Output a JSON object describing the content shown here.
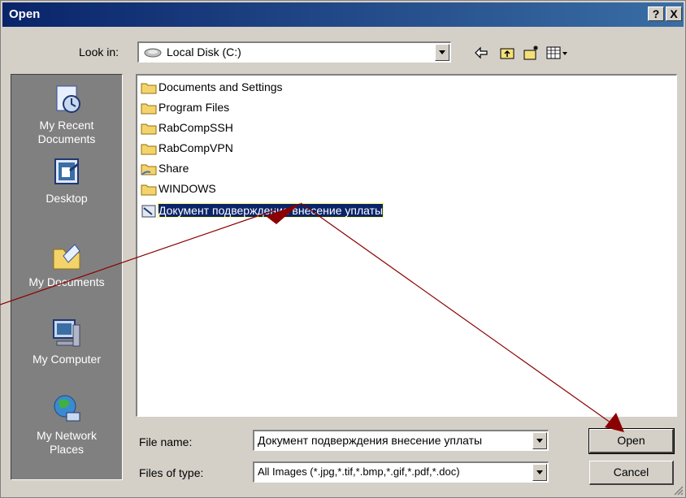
{
  "window": {
    "title": "Open"
  },
  "titlebar_buttons": {
    "help": "?",
    "close": "X"
  },
  "lookin": {
    "label": "Look in:",
    "value": "Local Disk (C:)"
  },
  "places": [
    {
      "label": "My Recent\nDocuments",
      "icon": "recent-documents-icon"
    },
    {
      "label": "Desktop",
      "icon": "desktop-icon"
    },
    {
      "label": "My Documents",
      "icon": "my-documents-icon"
    },
    {
      "label": "My Computer",
      "icon": "my-computer-icon"
    },
    {
      "label": "My Network\nPlaces",
      "icon": "network-places-icon"
    }
  ],
  "files": [
    {
      "name": "Documents and Settings",
      "type": "folder"
    },
    {
      "name": "Program Files",
      "type": "folder"
    },
    {
      "name": "RabCompSSH",
      "type": "folder"
    },
    {
      "name": "RabCompVPN",
      "type": "folder"
    },
    {
      "name": "Share",
      "type": "shared-folder"
    },
    {
      "name": "WINDOWS",
      "type": "folder"
    },
    {
      "name": "Документ подверждения внесение уплаты",
      "type": "document"
    }
  ],
  "filename": {
    "label": "File name:",
    "value": "Документ подверждения внесение уплаты"
  },
  "filetype": {
    "label": "Files of type:",
    "value": "All Images (*.jpg,*.tif,*.bmp,*.gif,*.pdf,*.doc)"
  },
  "buttons": {
    "open": "Open",
    "cancel": "Cancel"
  },
  "colors": {
    "title_bar": "#0a246a",
    "dialog_bg": "#d4d0c8",
    "places_bg": "#808080",
    "selection": "#0a246a",
    "arrow": "#8b0000"
  }
}
